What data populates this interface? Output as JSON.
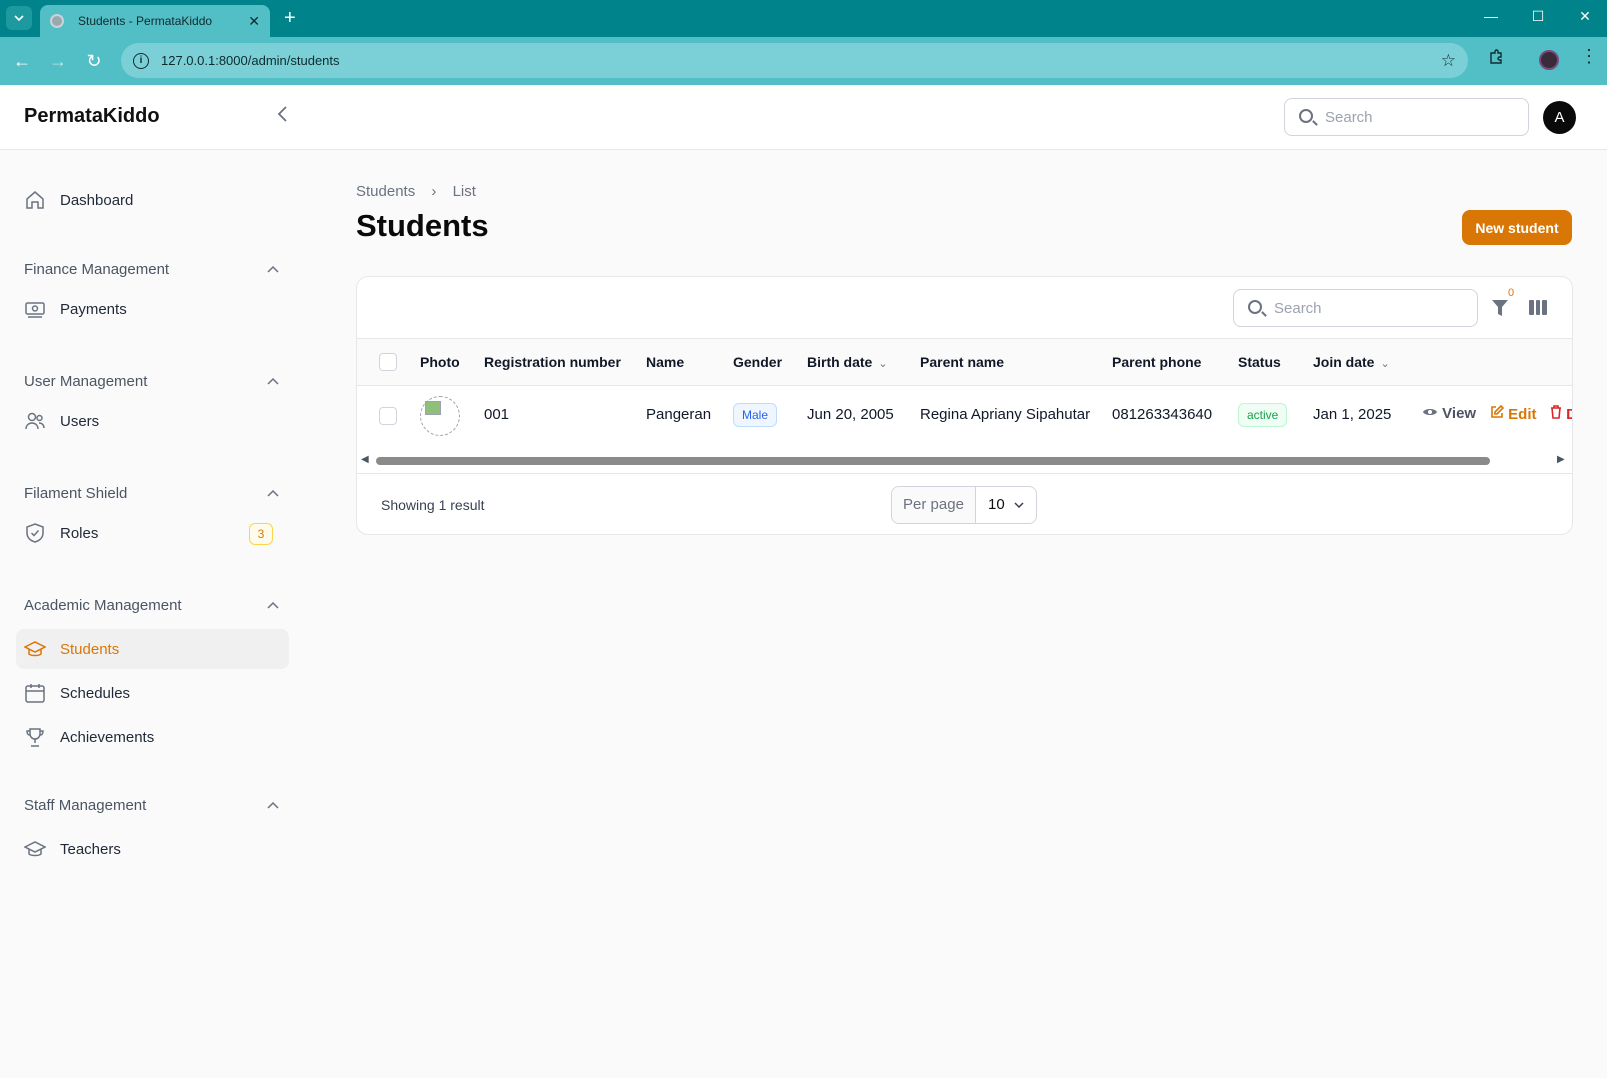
{
  "browser": {
    "tab_title": "Students - PermataKiddo",
    "tab_close": "✕",
    "new_tab": "+",
    "url": "127.0.0.1:8000/admin/students",
    "minimize": "—",
    "maximize": "☐",
    "close": "✕",
    "back": "←",
    "forward": "→",
    "reload": "↻",
    "menu": "⋮"
  },
  "topbar": {
    "brand": "PermataKiddo",
    "search_placeholder": "Search",
    "avatar_initial": "A"
  },
  "sidebar": {
    "dashboard": "Dashboard",
    "groups": {
      "finance": "Finance Management",
      "user": "User Management",
      "shield": "Filament Shield",
      "academic": "Academic Management",
      "staff": "Staff Management"
    },
    "items": {
      "payments": "Payments",
      "users": "Users",
      "roles": "Roles",
      "roles_badge": "3",
      "students": "Students",
      "schedules": "Schedules",
      "achievements": "Achievements",
      "teachers": "Teachers"
    }
  },
  "page": {
    "breadcrumb": [
      "Students",
      "List"
    ],
    "title": "Students",
    "new_button": "New student"
  },
  "table": {
    "search_placeholder": "Search",
    "filter_count": "0",
    "columns": [
      "Photo",
      "Registration number",
      "Name",
      "Gender",
      "Birth date",
      "Parent name",
      "Parent phone",
      "Status",
      "Join date"
    ],
    "rows": [
      {
        "registration_number": "001",
        "name": "Pangeran",
        "gender": "Male",
        "birth_date": "Jun 20, 2005",
        "parent_name": "Regina Apriany Sipahutar",
        "parent_phone": "081263343640",
        "status": "active",
        "join_date": "Jan 1, 2025",
        "actions": {
          "view": "View",
          "edit": "Edit",
          "delete": "D"
        }
      }
    ],
    "footer": {
      "showing": "Showing 1 result",
      "per_page_label": "Per page",
      "per_page_value": "10"
    }
  },
  "colors": {
    "accent": "#d97706",
    "chrome": "#00838a",
    "chrome_light": "#52bec6"
  }
}
